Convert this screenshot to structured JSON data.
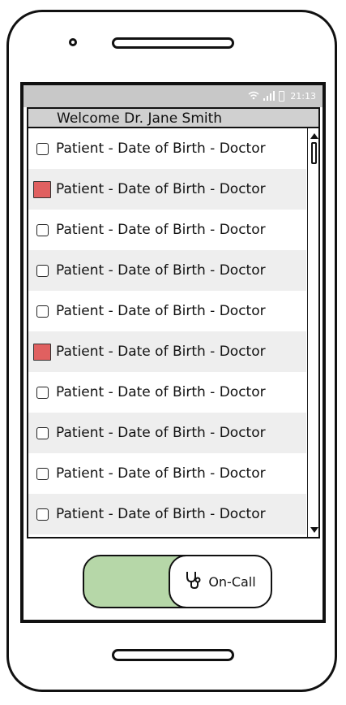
{
  "status_bar": {
    "wifi_icon": "wifi-icon",
    "signal_icon": "signal-icon",
    "battery_icon": "battery-icon",
    "time": "21:13"
  },
  "header": {
    "welcome": "Welcome Dr. Jane Smith"
  },
  "patient_list": [
    {
      "text": "Patient - Date of Birth - Doctor",
      "flagged": false
    },
    {
      "text": "Patient - Date of Birth - Doctor",
      "flagged": true
    },
    {
      "text": "Patient - Date of Birth - Doctor",
      "flagged": false
    },
    {
      "text": "Patient - Date of Birth - Doctor",
      "flagged": false
    },
    {
      "text": "Patient - Date of Birth - Doctor",
      "flagged": false
    },
    {
      "text": "Patient - Date of Birth - Doctor",
      "flagged": true
    },
    {
      "text": "Patient - Date of Birth - Doctor",
      "flagged": false
    },
    {
      "text": "Patient - Date of Birth - Doctor",
      "flagged": false
    },
    {
      "text": "Patient - Date of Birth - Doctor",
      "flagged": false
    },
    {
      "text": "Patient - Date of Birth - Doctor",
      "flagged": false
    }
  ],
  "toggle": {
    "label": "On-Call",
    "icon": "stethoscope-icon",
    "state": "on"
  },
  "colors": {
    "flag": "#e06060",
    "toggle_on": "#b6d7a8",
    "alt_row": "#eeeeee",
    "status_bar": "#c8c8c8"
  }
}
